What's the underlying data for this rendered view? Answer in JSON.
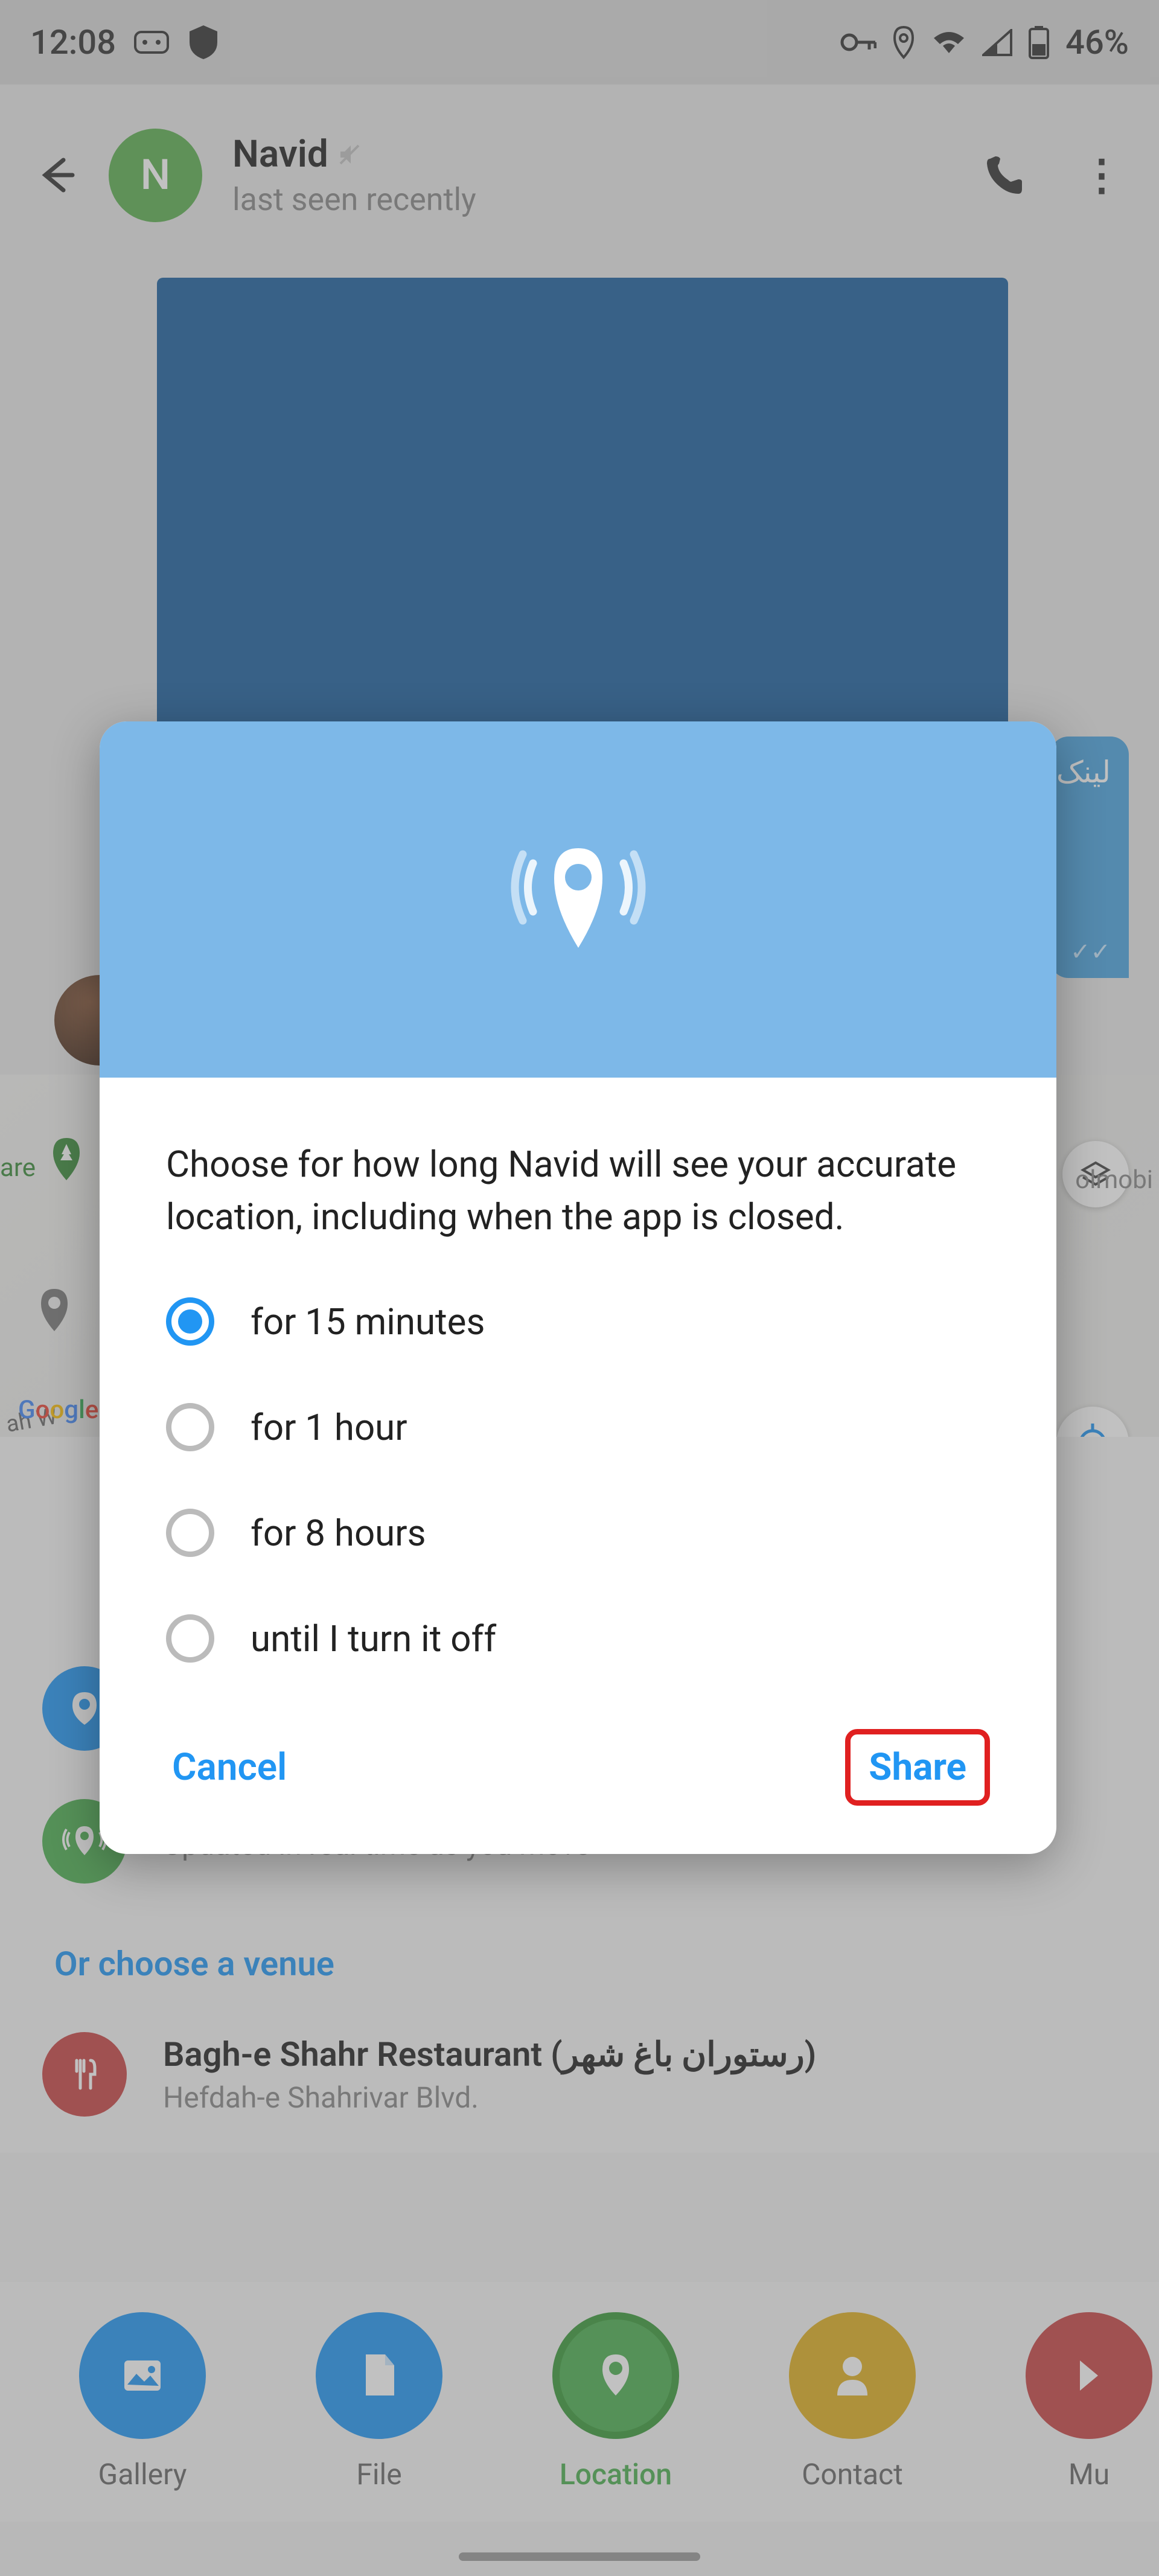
{
  "status": {
    "time": "12:08",
    "battery_pct": "46%",
    "icons": [
      "security",
      "key",
      "location",
      "wifi",
      "signal",
      "battery"
    ]
  },
  "chat": {
    "name": "Navid",
    "status": "last seen recently",
    "avatar_letter": "N",
    "avatar_color": "#5CAF50",
    "muted": true,
    "message_snippet": "لینک"
  },
  "map": {
    "park_label": "are",
    "street_label": "ah W",
    "google": "Google",
    "mobi_label": "olmobi"
  },
  "location_options": {
    "live_subtitle": "Updated in real time as you move"
  },
  "venue": {
    "header": "Or choose a venue",
    "items": [
      {
        "name": "Bagh-e Shahr Restaurant (رستوران باغ شهر)",
        "address": "Hefdah-e Shahrivar Blvd."
      }
    ]
  },
  "attach": {
    "items": [
      {
        "label": "Gallery",
        "color": "#2196F3"
      },
      {
        "label": "File",
        "color": "#2196F3"
      },
      {
        "label": "Location",
        "color": "#4CAF50",
        "active": true
      },
      {
        "label": "Contact",
        "color": "#e0b020"
      },
      {
        "label": "Mu",
        "color": "#c94545"
      }
    ]
  },
  "dialog": {
    "prompt": "Choose for how long Navid will see your accurate location, including when the app is closed.",
    "options": [
      "for 15 minutes",
      "for 1 hour",
      "for 8 hours",
      "until I turn it off"
    ],
    "selected_index": 0,
    "cancel": "Cancel",
    "share": "Share"
  }
}
